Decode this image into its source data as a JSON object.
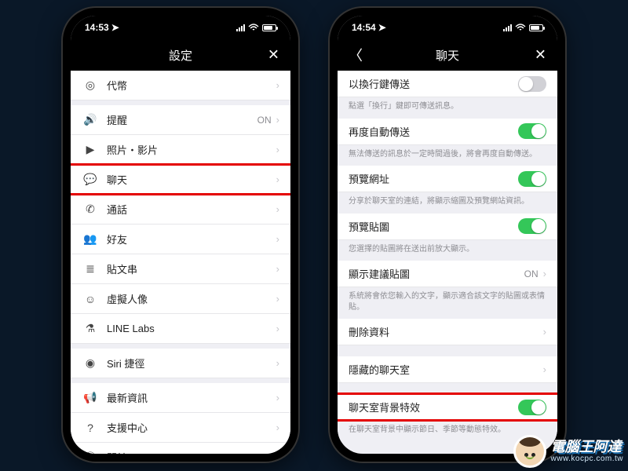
{
  "colors": {
    "highlight": "#e40000",
    "toggle_on": "#34c759"
  },
  "watermark": {
    "title": "電腦王阿達",
    "url": "www.kocpc.com.tw"
  },
  "phoneA": {
    "time": "14:53",
    "title": "設定",
    "groups": [
      {
        "items": [
          {
            "icon": "coin",
            "label": "代幣"
          }
        ]
      },
      {
        "items": [
          {
            "icon": "speaker",
            "label": "提醒",
            "value": "ON"
          },
          {
            "icon": "video",
            "label": "照片・影片"
          },
          {
            "icon": "chat",
            "label": "聊天",
            "highlight": true
          },
          {
            "icon": "phone",
            "label": "通話"
          },
          {
            "icon": "friend",
            "label": "好友"
          },
          {
            "icon": "timeline",
            "label": "貼文串"
          },
          {
            "icon": "avatar",
            "label": "虛擬人像"
          },
          {
            "icon": "flask",
            "label": "LINE Labs"
          }
        ]
      },
      {
        "items": [
          {
            "icon": "siri",
            "label": "Siri 捷徑"
          }
        ]
      },
      {
        "items": [
          {
            "icon": "announce",
            "label": "最新資訊"
          },
          {
            "icon": "help",
            "label": "支援中心"
          },
          {
            "icon": "info",
            "label": "關於LINE"
          }
        ]
      }
    ]
  },
  "phoneB": {
    "time": "14:54",
    "title": "聊天",
    "rows": [
      {
        "label": "以換行鍵傳送",
        "control": "toggle",
        "on": false,
        "desc": "點選「換行」鍵即可傳送訊息。"
      },
      {
        "label": "再度自動傳送",
        "control": "toggle",
        "on": true,
        "desc": "無法傳送的訊息於一定時間過後，將會再度自動傳送。"
      },
      {
        "label": "預覽網址",
        "control": "toggle",
        "on": true,
        "desc": "分享於聊天室的連結，將顯示縮圖及預覽網站資訊。"
      },
      {
        "label": "預覽貼圖",
        "control": "toggle",
        "on": true,
        "desc": "您選擇的貼圖將在送出前放大顯示。"
      },
      {
        "label": "顯示建議貼圖",
        "control": "value",
        "value": "ON",
        "desc": "系統將會依您輸入的文字，顯示適合該文字的貼圖或表情貼。"
      },
      {
        "label": "刪除資料",
        "control": "chevron"
      },
      {
        "gap": true
      },
      {
        "label": "隱藏的聊天室",
        "control": "chevron"
      },
      {
        "gap": true
      },
      {
        "label": "聊天室背景特效",
        "control": "toggle",
        "on": true,
        "highlight": true,
        "desc": "在聊天室背景中顯示節日、季節等動態特效。"
      }
    ]
  }
}
